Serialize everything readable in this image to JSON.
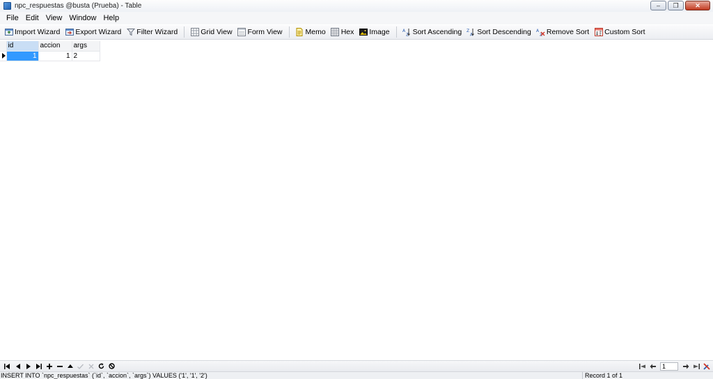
{
  "window": {
    "title": "npc_respuestas @busta (Prueba) - Table",
    "controls": {
      "minimize": "–",
      "restore": "❐",
      "close": "✕"
    }
  },
  "menu": [
    "File",
    "Edit",
    "View",
    "Window",
    "Help"
  ],
  "toolbar": {
    "import_wizard": "Import Wizard",
    "export_wizard": "Export Wizard",
    "filter_wizard": "Filter Wizard",
    "grid_view": "Grid View",
    "form_view": "Form View",
    "memo": "Memo",
    "hex": "Hex",
    "image": "Image",
    "sort_ascending": "Sort Ascending",
    "sort_descending": "Sort Descending",
    "remove_sort": "Remove Sort",
    "custom_sort": "Custom Sort"
  },
  "table": {
    "columns": [
      "id",
      "accion",
      "args"
    ],
    "rows": [
      {
        "id": "1",
        "accion": "1",
        "args": "2"
      }
    ]
  },
  "navigator": {
    "page": "1",
    "icons": [
      "first-record",
      "prev-record",
      "next-record",
      "last-record",
      "add-record",
      "delete-record",
      "move-up",
      "apply",
      "cancel",
      "refresh",
      "stop"
    ]
  },
  "status": {
    "sql": "INSERT INTO `npc_respuestas` (`id`, `accion`, `args`) VALUES ('1', '1', '2')",
    "record": "Record 1 of 1"
  },
  "colors": {
    "selection": "#3399ff",
    "header_selected": "#c9def5"
  }
}
